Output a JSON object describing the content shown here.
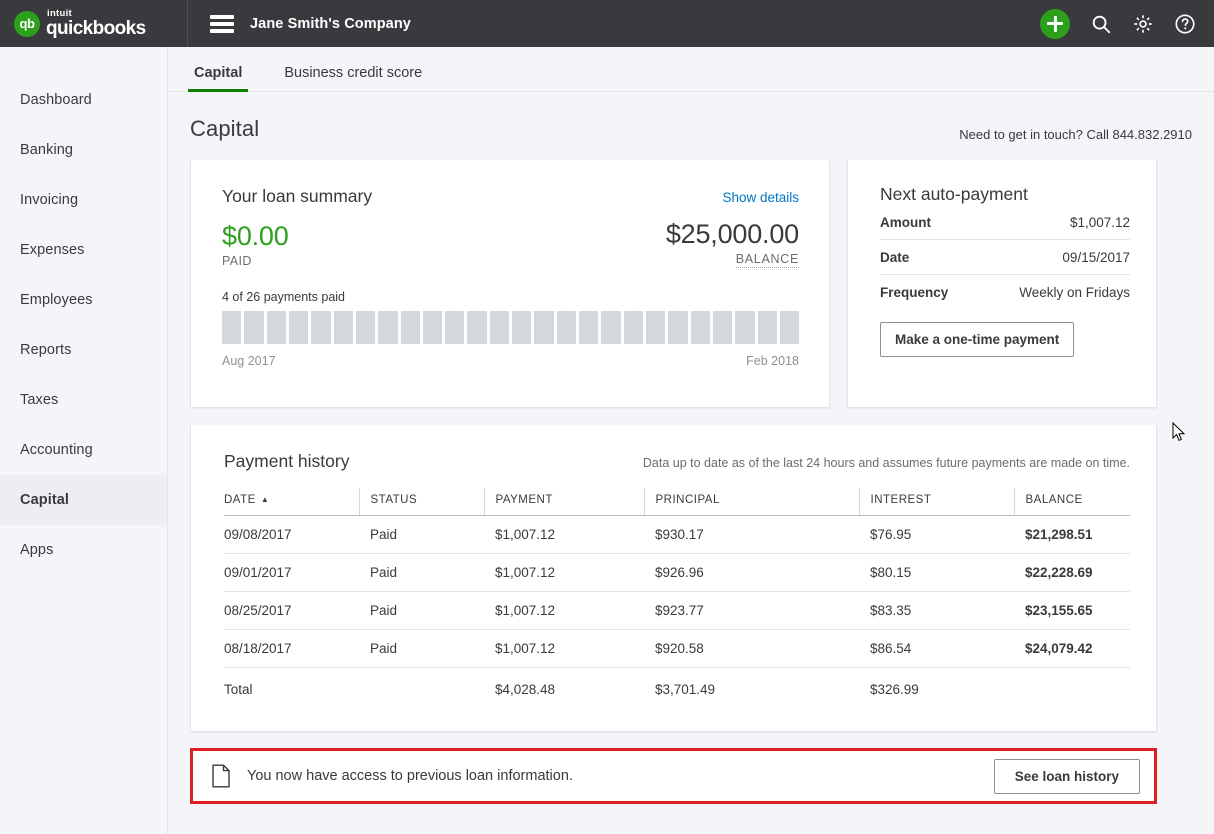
{
  "topbar": {
    "brand_intuit": "intuit",
    "brand_name": "quickbooks",
    "brand_mark": "qb",
    "company": "Jane Smith's Company",
    "icons": {
      "menu": "hamburger-menu-icon",
      "add": "plus-icon",
      "search": "search-icon",
      "settings": "gear-icon",
      "help": "help-icon"
    }
  },
  "sidebar": {
    "items": [
      {
        "label": "Dashboard",
        "active": false
      },
      {
        "label": "Banking",
        "active": false
      },
      {
        "label": "Invoicing",
        "active": false
      },
      {
        "label": "Expenses",
        "active": false
      },
      {
        "label": "Employees",
        "active": false
      },
      {
        "label": "Reports",
        "active": false
      },
      {
        "label": "Taxes",
        "active": false
      },
      {
        "label": "Accounting",
        "active": false
      },
      {
        "label": "Capital",
        "active": true
      },
      {
        "label": "Apps",
        "active": false
      }
    ]
  },
  "tabs": [
    {
      "label": "Capital",
      "active": true
    },
    {
      "label": "Business credit score",
      "active": false
    }
  ],
  "page": {
    "title": "Capital",
    "contact_note": "Need to get in touch? Call 844.832.2910"
  },
  "loan_summary": {
    "heading": "Your loan summary",
    "show_details": "Show details",
    "paid_amount": "$0.00",
    "paid_label": "PAID",
    "balance_amount": "$25,000.00",
    "balance_label": "BALANCE",
    "progress_label": "4 of 26 payments paid",
    "payments_paid": 4,
    "payments_total": 26,
    "start_date": "Aug 2017",
    "end_date": "Feb 2018",
    "paid_color": "#2ca01c",
    "link_color": "#0077c5"
  },
  "next_payment": {
    "heading": "Next auto-payment",
    "rows": [
      {
        "key": "Amount",
        "value": "$1,007.12"
      },
      {
        "key": "Date",
        "value": "09/15/2017"
      },
      {
        "key": "Frequency",
        "value": "Weekly on Fridays"
      }
    ],
    "button": "Make a one-time payment"
  },
  "payment_history": {
    "heading": "Payment history",
    "note": "Data up to date as of the last 24 hours and assumes future payments are made on time.",
    "sort_column": "DATE",
    "sort_arrow": "▲",
    "columns": [
      "DATE",
      "STATUS",
      "PAYMENT",
      "PRINCIPAL",
      "INTEREST",
      "BALANCE"
    ],
    "rows": [
      {
        "date": "09/08/2017",
        "status": "Paid",
        "payment": "$1,007.12",
        "principal": "$930.17",
        "interest": "$76.95",
        "balance": "$21,298.51"
      },
      {
        "date": "09/01/2017",
        "status": "Paid",
        "payment": "$1,007.12",
        "principal": "$926.96",
        "interest": "$80.15",
        "balance": "$22,228.69"
      },
      {
        "date": "08/25/2017",
        "status": "Paid",
        "payment": "$1,007.12",
        "principal": "$923.77",
        "interest": "$83.35",
        "balance": "$23,155.65"
      },
      {
        "date": "08/18/2017",
        "status": "Paid",
        "payment": "$1,007.12",
        "principal": "$920.58",
        "interest": "$86.54",
        "balance": "$24,079.42"
      }
    ],
    "total": {
      "label": "Total",
      "status": "",
      "payment": "$4,028.48",
      "principal": "$3,701.49",
      "interest": "$326.99",
      "balance": ""
    }
  },
  "banner": {
    "icon": "document-icon",
    "text": "You now have access to previous loan information.",
    "button": "See loan history",
    "highlight_color": "#e01f24"
  }
}
